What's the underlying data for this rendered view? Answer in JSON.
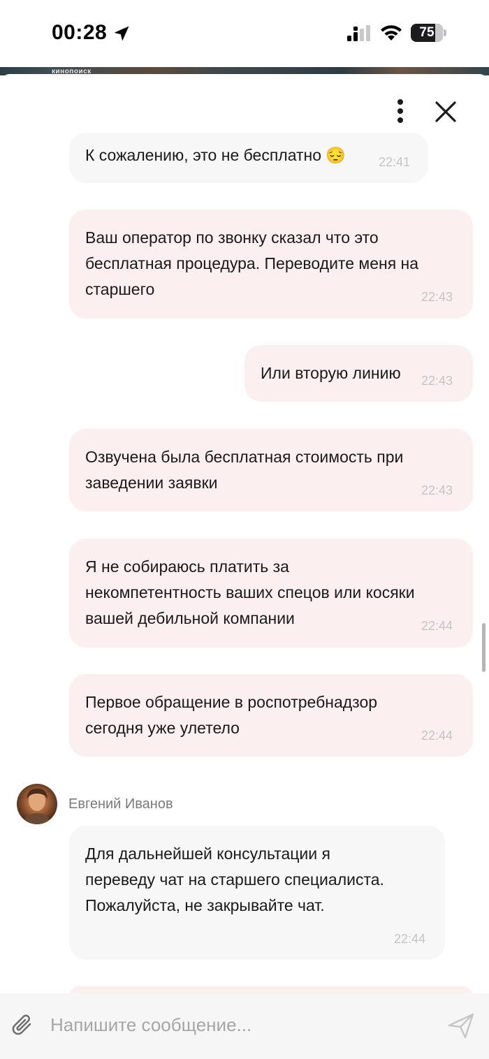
{
  "status_bar": {
    "time": "00:28",
    "battery": "75",
    "battery_level": 0.75
  },
  "banner": {
    "logo_text": "кинопоиск"
  },
  "header": {
    "menu_icon": "more-vertical-icon",
    "close_icon": "close-icon"
  },
  "messages": [
    {
      "direction": "in",
      "text": "К сожалению, это не бесплатно 😔",
      "time": "22:41"
    },
    {
      "direction": "out",
      "text": "Ваш оператор по звонку сказал что это бесплатная процедура. Переводите меня на старшего",
      "time": "22:43"
    },
    {
      "direction": "out",
      "text": "Или вторую линию",
      "time": "22:43"
    },
    {
      "direction": "out",
      "text": "Озвучена была бесплатная стоимость при заведении заявки",
      "time": "22:43"
    },
    {
      "direction": "out",
      "text": "Я не собираюсь платить за некомпетентность ваших спецов или косяки вашей дебильной компании",
      "time": "22:44"
    },
    {
      "direction": "out",
      "text": "Первое обращение в роспотребнадзор сегодня уже улетело",
      "time": "22:44"
    },
    {
      "direction": "in",
      "text": "Для дальнейшей консультации я переведу чат на старшего специалиста. Пожалуйста, не закрывайте чат.",
      "time": "22:44"
    }
  ],
  "operator": {
    "name": "Евгений Иванов"
  },
  "composer": {
    "placeholder": "Напишите сообщение...",
    "value": "",
    "attach_icon": "paperclip-icon",
    "send_icon": "send-icon"
  },
  "colors": {
    "incoming_bubble": "#f7f7f7",
    "outgoing_bubble": "#fcefef",
    "timestamp": "#c4c4c4",
    "input_bar": "#f6f6f6"
  }
}
